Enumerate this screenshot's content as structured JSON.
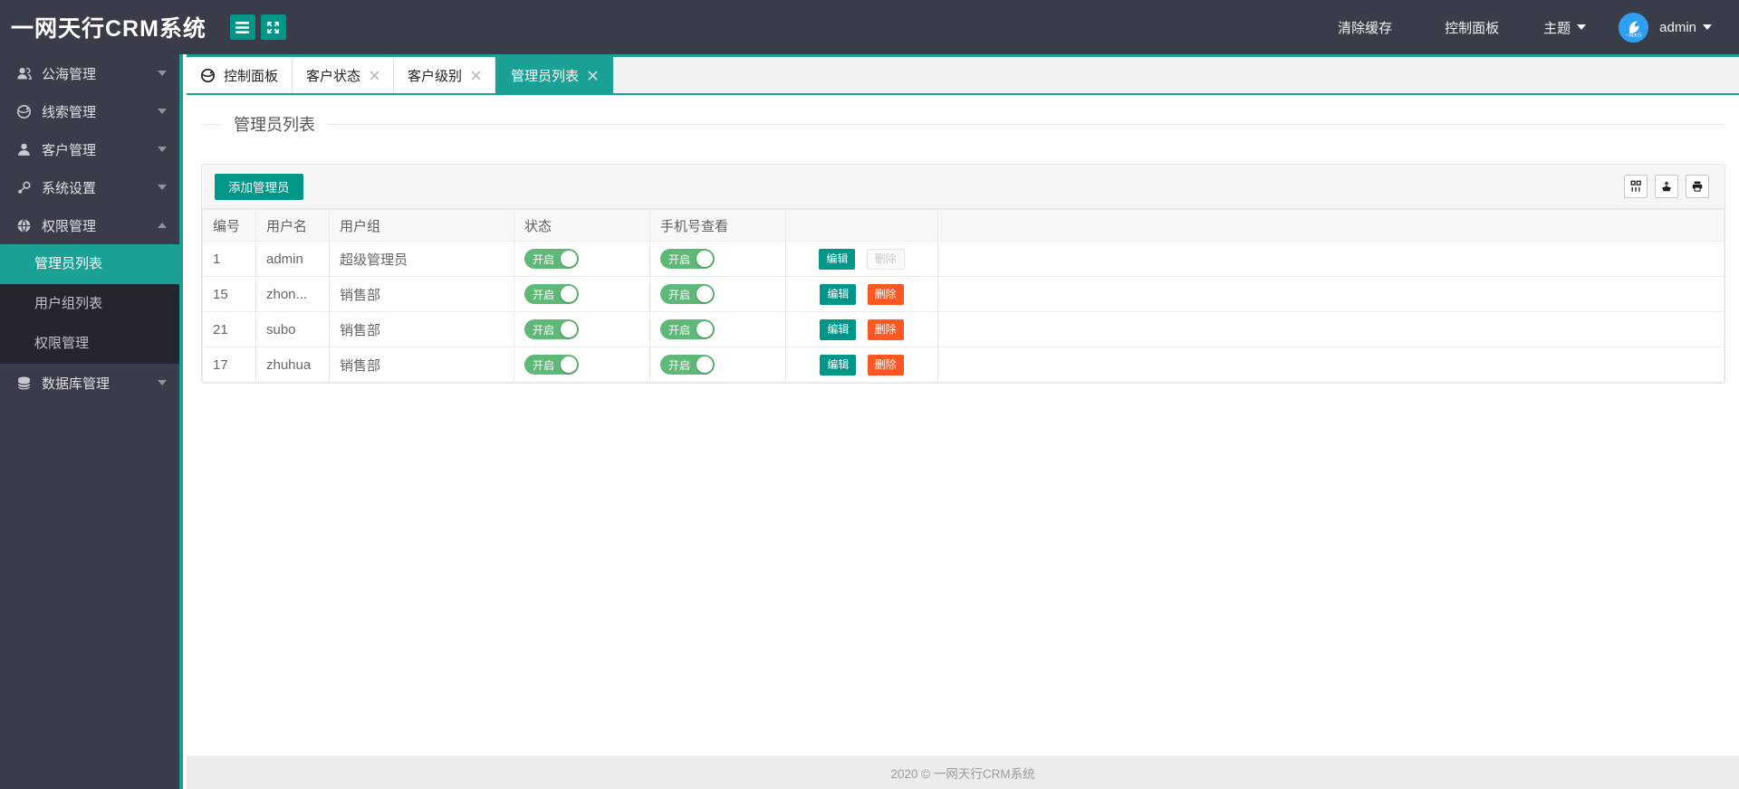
{
  "colors": {
    "accent": "#1AA094",
    "button": "#009688",
    "toggle_on": "#5FB878",
    "danger": "#FF5722",
    "header_bg": "#393D49"
  },
  "header": {
    "logo": "一网天行CRM系统",
    "clear_cache": "清除缓存",
    "control_panel": "控制面板",
    "theme": "主题",
    "username": "admin"
  },
  "sidebar": {
    "items": [
      {
        "label": "公海管理",
        "icon": "users-icon"
      },
      {
        "label": "线索管理",
        "icon": "globe-icon"
      },
      {
        "label": "客户管理",
        "icon": "user-icon"
      },
      {
        "label": "系统设置",
        "icon": "settings-icon"
      },
      {
        "label": "权限管理",
        "icon": "permission-icon",
        "expanded": true,
        "children": [
          {
            "label": "管理员列表",
            "active": true
          },
          {
            "label": "用户组列表"
          },
          {
            "label": "权限管理"
          }
        ]
      },
      {
        "label": "数据库管理",
        "icon": "database-icon"
      }
    ]
  },
  "tabs": [
    {
      "label": "控制面板",
      "icon": "globe-icon",
      "closable": false
    },
    {
      "label": "客户状态",
      "closable": true
    },
    {
      "label": "客户级别",
      "closable": true
    },
    {
      "label": "管理员列表",
      "closable": true,
      "active": true
    }
  ],
  "page": {
    "title": "管理员列表"
  },
  "toolbar": {
    "add_button": "添加管理员",
    "icons": [
      {
        "name": "columns-filter-icon"
      },
      {
        "name": "export-icon"
      },
      {
        "name": "print-icon"
      }
    ]
  },
  "table": {
    "headers": [
      "编号",
      "用户名",
      "用户组",
      "状态",
      "手机号查看",
      ""
    ],
    "rows": [
      {
        "id": "1",
        "username": "admin",
        "group": "超级管理员",
        "status": "开启",
        "phone_view": "开启",
        "actions": {
          "edit": "编辑",
          "delete": "删除",
          "delete_disabled": true
        }
      },
      {
        "id": "15",
        "username": "zhon...",
        "group": "销售部",
        "status": "开启",
        "phone_view": "开启",
        "actions": {
          "edit": "编辑",
          "delete": "删除",
          "delete_disabled": false
        }
      },
      {
        "id": "21",
        "username": "subo",
        "group": "销售部",
        "status": "开启",
        "phone_view": "开启",
        "actions": {
          "edit": "编辑",
          "delete": "删除",
          "delete_disabled": false
        }
      },
      {
        "id": "17",
        "username": "zhuhua",
        "group": "销售部",
        "status": "开启",
        "phone_view": "开启",
        "actions": {
          "edit": "编辑",
          "delete": "删除",
          "delete_disabled": false
        }
      }
    ]
  },
  "footer": {
    "copyright": "2020 ©  一网天行CRM系统"
  }
}
